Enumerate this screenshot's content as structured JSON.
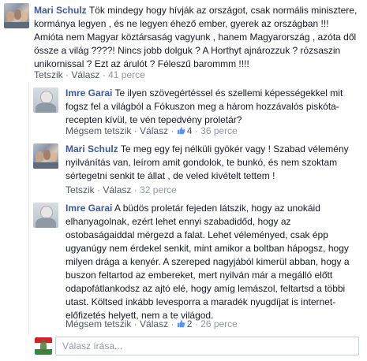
{
  "comments": [
    {
      "author": "Mari Schulz",
      "text_lines": [
        "Tök mindegy hogy hívják az országot, csak normális minisztere,",
        "kormánya legyen , és ne legyen éhező ember, gyerek az országban !!!",
        "Amióta nem Magyar köztársaság vagyunk , hanem Magyarország , azóta dől",
        "össze a világ ????! Nincs jobb dolguk ? A Horthyt ajnározzuk ? rózsaszin",
        "unikornissal ? Ezt az árulót ? Féleszű barommm !!!!"
      ],
      "like_label": "Tetszik",
      "reply_label": "Válasz",
      "sep": "·",
      "time": "41 perce"
    },
    {
      "author": "Imre Garai",
      "text_lines": [
        "Te ilyen szövegértéssel és szellemi képességekkel mit",
        "fogsz fel a világból a Fókuszon meg a három hozzávalós piskóta-",
        "recepten kívül, te vén tepedvény proletár?"
      ],
      "like_label": "Mégsem tetszik",
      "reply_label": "Válasz",
      "sep": "·",
      "likes": "4",
      "time": "36 perce"
    },
    {
      "author": "Mari Schulz",
      "text_lines": [
        "Te meg egy fej nélküli gyökér vagy ! Szabad vélemény",
        "nyilvánítás van, leírom amit gondolok, te bunkó, és nem szoktam",
        "sértegetni senkit te állat , de veled kivételt tettem !"
      ],
      "like_label": "Tetszik",
      "reply_label": "Válasz",
      "sep": "·",
      "time": "32 perce"
    },
    {
      "author": "Imre Garai",
      "text_lines": [
        "A büdös proletár fejeden látszik, hogy az unokáid",
        "elhanyagolnak, ezért lehet ennyi szabadidőd, hogy az",
        "ostobaságaiddal mérgezd a falat. Lehet véleményed, csak épp",
        "ugyanúgy nem érdekel senkit, mint amikor a boltban hápogsz, hogy",
        "milyen drága a kenyér. A szereped nagyjából kimerül abban, hogy a",
        "buszon feltartod az embereket, mert nyilván már a megálló előtt",
        "odapofátlankodsz az ajtó elé, hogy amíg lemászol, feltartsd a többi",
        "utast. Költsed inkább levesporra a maradék nyugdíjat is internet-",
        "előfizetés helyett, nem a te világod."
      ],
      "like_label": "Mégsem tetszik",
      "reply_label": "Válasz",
      "sep": "·",
      "likes": "2",
      "time": "26 perce"
    }
  ],
  "reply_box": {
    "placeholder": "Válasz írása..."
  },
  "colors": {
    "link": "#3b5998",
    "meta": "#9197a3",
    "text": "#141823"
  },
  "icons": {
    "like": "thumbs-up-icon"
  }
}
